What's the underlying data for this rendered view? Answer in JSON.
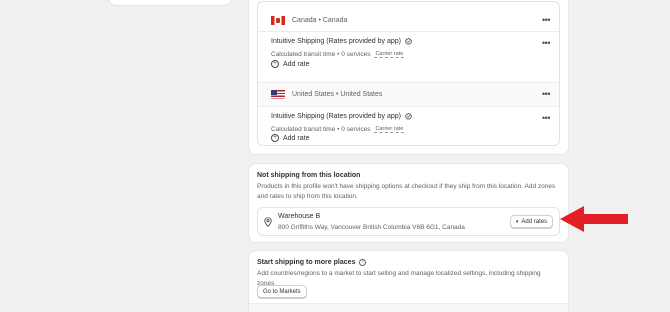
{
  "shipping_zones": [
    {
      "zone_label": "Canada • Canada",
      "flag": "canada-flag",
      "rate": {
        "name": "Intuitive Shipping (Rates provided by app)",
        "transit": "Calculated transit time • 0 services",
        "badge": "Carrier rate"
      },
      "add_rate_label": "Add rate"
    },
    {
      "zone_label": "United States • United States",
      "flag": "us-flag",
      "rate": {
        "name": "Intuitive Shipping (Rates provided by app)",
        "transit": "Calculated transit time • 0 services",
        "badge": "Carrier rate"
      },
      "add_rate_label": "Add rate"
    }
  ],
  "not_shipping": {
    "title": "Not shipping from this location",
    "description": "Products in this profile won't have shipping options at checkout if they ship from this location. Add zones and rates to ship from this location.",
    "warehouse": {
      "name": "Warehouse B",
      "address": "800 Griffiths Way, Vancouver British Columbia V6B 6G1, Canada",
      "button_label": "Add rates"
    }
  },
  "start_shipping": {
    "title": "Start shipping to more places",
    "description": "Add countries/regions to a market to start selling and manage localized settings, including shipping zones",
    "button_label": "Go to Markets"
  },
  "menu_glyph": "•••",
  "colors": {
    "background": "#f1f1f1",
    "card": "#ffffff",
    "annotation_arrow": "#e31e24"
  }
}
